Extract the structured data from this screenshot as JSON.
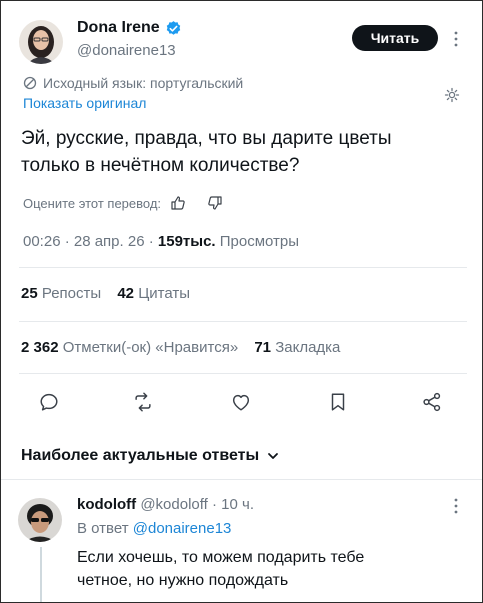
{
  "author": {
    "name": "Dona Irene",
    "handle": "@donairene13",
    "follow_label": "Читать"
  },
  "translation": {
    "source_lang": "Исходный язык: португальский",
    "show_original": "Показать оригинал",
    "rate_label": "Оцените этот перевод:"
  },
  "tweet": {
    "text_line1": "Эй, русские, правда, что вы дарите цветы",
    "text_line2": "только в нечётном количестве?",
    "meta": "00:26 · 28 апр. 26 · ",
    "views_num": "159тыс.",
    "views_label": "Просмотры"
  },
  "stats": {
    "reposts_num": "25",
    "reposts_label": "Репосты",
    "quotes_num": "42",
    "quotes_label": "Цитаты",
    "likes_num": "2 362",
    "likes_label": "Отметки(-ок) «Нравится»",
    "bookmarks_num": "71",
    "bookmarks_label": "Закладка"
  },
  "replies_header": {
    "label": "Наиболее актуальные ответы"
  },
  "reply": {
    "name": "kodoloff",
    "handle": "@kodoloff",
    "time": "· 10 ч.",
    "in_reply_prefix": "В ответ",
    "in_reply_handle": "@donairene13",
    "text_line1": "Если хочешь, то можем подарить тебе",
    "text_line2": "четное, но нужно подождать"
  },
  "colors": {
    "accent": "#1d9bf0",
    "verified": "#1d9bf0",
    "text": "#0f1419",
    "muted": "#6b7580"
  }
}
